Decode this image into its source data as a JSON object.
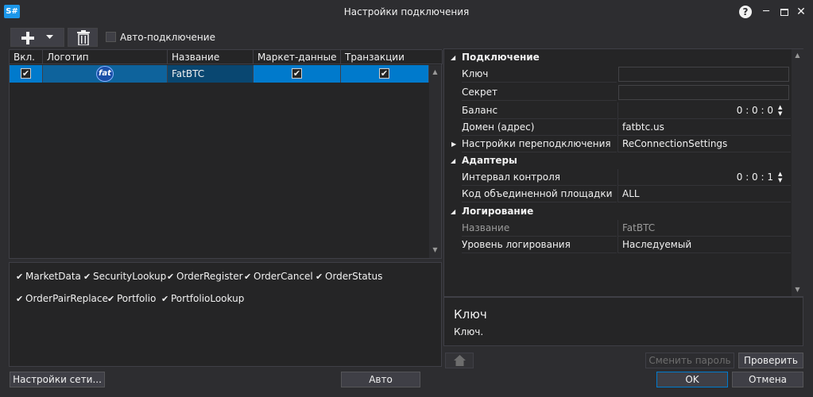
{
  "window": {
    "logo": "S#",
    "title": "Настройки подключения"
  },
  "toolbar": {
    "add_icon": "plus-icon",
    "delete_icon": "trash-icon",
    "auto_connect_label": "Авто-подключение"
  },
  "grid": {
    "columns": [
      "Вкл.",
      "Логотип",
      "Название",
      "Маркет-данные",
      "Транзакции"
    ],
    "rows": [
      {
        "enabled": true,
        "logo": "fat",
        "name": "FatBTC",
        "market_data": true,
        "transactions": true
      }
    ]
  },
  "transactions": [
    "MarketData",
    "SecurityLookup",
    "OrderRegister",
    "OrderCancel",
    "OrderStatus",
    "OrderPairReplace",
    "Portfolio",
    "PortfolioLookup"
  ],
  "properties": {
    "cat_connection": "Подключение",
    "key": "Ключ",
    "secret": "Секрет",
    "balance": "Баланс",
    "balance_value": "0 : 0 : 0",
    "domain": "Домен (адрес)",
    "domain_value": "fatbtc.us",
    "reconnect": "Настройки переподключения",
    "reconnect_value": "ReConnectionSettings",
    "cat_adapters": "Адаптеры",
    "interval": "Интервал контроля",
    "interval_value": "0 : 0 : 1",
    "board": "Код объединенной площадки",
    "board_value": "ALL",
    "cat_logging": "Логирование",
    "log_name": "Название",
    "log_name_value": "FatBTC",
    "log_level": "Уровень логирования",
    "log_level_value": "Наследуемый"
  },
  "description": {
    "title": "Ключ",
    "text": "Ключ."
  },
  "buttons": {
    "change_password": "Сменить пароль",
    "check": "Проверить",
    "network": "Настройки сети...",
    "auto": "Авто",
    "ok": "OK",
    "cancel": "Отмена"
  }
}
